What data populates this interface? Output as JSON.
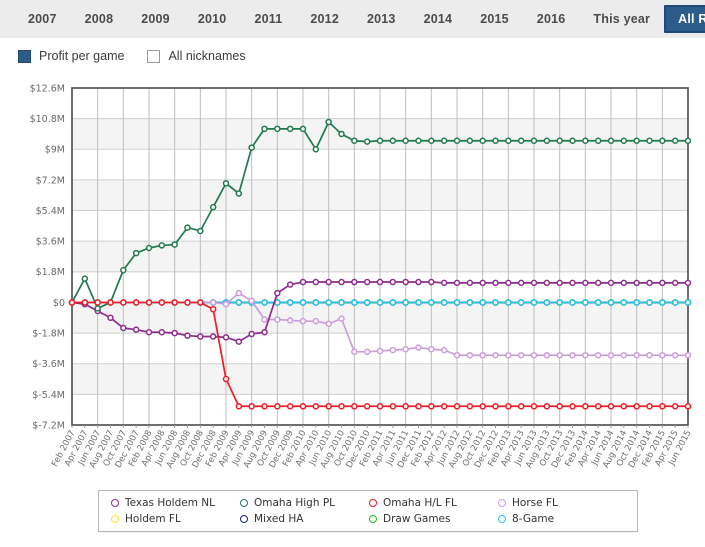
{
  "toolbar": {
    "tabs": [
      {
        "label": "2007",
        "active": false
      },
      {
        "label": "2008",
        "active": false
      },
      {
        "label": "2009",
        "active": false
      },
      {
        "label": "2010",
        "active": false
      },
      {
        "label": "2011",
        "active": false
      },
      {
        "label": "2012",
        "active": false
      },
      {
        "label": "2013",
        "active": false
      },
      {
        "label": "2014",
        "active": false
      },
      {
        "label": "2015",
        "active": false
      },
      {
        "label": "2016",
        "active": false
      },
      {
        "label": "This year",
        "active": false
      },
      {
        "label": "All Results",
        "active": true
      }
    ],
    "active_color": "#2e5c8a"
  },
  "options": [
    {
      "label": "Profit per game",
      "checked": true
    },
    {
      "label": "All nicknames",
      "checked": false
    }
  ],
  "chart_data": {
    "type": "line",
    "title": "",
    "xlabel": "",
    "ylabel": "",
    "ylim": [
      -7.2,
      12.6
    ],
    "ytick_values": [
      12.6,
      10.8,
      9,
      7.2,
      5.4,
      3.6,
      1.8,
      0,
      -1.8,
      -3.6,
      -5.4,
      -7.2
    ],
    "ytick_labels": [
      "$12.6M",
      "$10.8M",
      "$9M",
      "$7.2M",
      "$5.4M",
      "$3.6M",
      "$1.8M",
      "$0",
      "$-1.8M",
      "$-3.6M",
      "$-5.4M",
      "$-7.2M"
    ],
    "grid": true,
    "legend_position": "bottom",
    "units": "millions of dollars",
    "categories": [
      "Feb 2007",
      "Apr 2007",
      "Jun 2007",
      "Aug 2007",
      "Oct 2007",
      "Dec 2007",
      "Feb 2008",
      "Apr 2008",
      "Jun 2008",
      "Aug 2008",
      "Oct 2008",
      "Dec 2008",
      "Feb 2009",
      "Apr 2009",
      "Jun 2009",
      "Aug 2009",
      "Oct 2009",
      "Dec 2009",
      "Feb 2010",
      "Apr 2010",
      "Jun 2010",
      "Aug 2010",
      "Oct 2010",
      "Dec 2010",
      "Feb 2011",
      "Apr 2011",
      "Jun 2011",
      "Dec 2011",
      "Feb 2012",
      "Apr 2012",
      "Jun 2012",
      "Aug 2012",
      "Oct 2012",
      "Dec 2012",
      "Feb 2013",
      "Apr 2013",
      "Jun 2013",
      "Aug 2013",
      "Oct 2013",
      "Dec 2013",
      "Feb 2014",
      "Apr 2014",
      "Jun 2014",
      "Aug 2014",
      "Oct 2014",
      "Dec 2014",
      "Feb 2015",
      "Apr 2015",
      "Jun 2015"
    ],
    "series": [
      {
        "name": "Texas Holdem NL",
        "color": "#8e2b8e",
        "values": [
          0.0,
          -0.1,
          -0.5,
          -0.9,
          -1.5,
          -1.6,
          -1.75,
          -1.75,
          -1.8,
          -1.95,
          -2.0,
          -2.0,
          -2.05,
          -2.3,
          -1.85,
          -1.75,
          0.55,
          1.05,
          1.2,
          1.2,
          1.2,
          1.2,
          1.2,
          1.2,
          1.2,
          1.2,
          1.2,
          1.2,
          1.2,
          1.15,
          1.15,
          1.15,
          1.15,
          1.15,
          1.15,
          1.15,
          1.15,
          1.15,
          1.15,
          1.15,
          1.15,
          1.15,
          1.15,
          1.15,
          1.15,
          1.15,
          1.15,
          1.15,
          1.15
        ]
      },
      {
        "name": "Omaha High PL",
        "color": "#1f7a4d",
        "values": [
          0.0,
          1.4,
          -0.35,
          0.0,
          1.9,
          2.9,
          3.2,
          3.35,
          3.4,
          4.4,
          4.2,
          5.6,
          7.0,
          6.4,
          9.1,
          10.2,
          10.2,
          10.2,
          10.2,
          9.0,
          10.6,
          9.9,
          9.5,
          9.45,
          9.5,
          9.5,
          9.5,
          9.5,
          9.5,
          9.5,
          9.5,
          9.5,
          9.5,
          9.5,
          9.5,
          9.5,
          9.5,
          9.5,
          9.5,
          9.5,
          9.5,
          9.5,
          9.5,
          9.5,
          9.5,
          9.5,
          9.5,
          9.5,
          9.5
        ]
      },
      {
        "name": "Omaha H/L FL",
        "color": "#ee1c25",
        "values": [
          0.0,
          0.0,
          0.0,
          0.0,
          0.0,
          0.0,
          0.0,
          0.0,
          0.0,
          0.0,
          0.0,
          -0.4,
          -4.5,
          -6.1,
          -6.1,
          -6.1,
          -6.1,
          -6.1,
          -6.1,
          -6.1,
          -6.1,
          -6.1,
          -6.1,
          -6.1,
          -6.1,
          -6.1,
          -6.1,
          -6.1,
          -6.1,
          -6.1,
          -6.1,
          -6.1,
          -6.1,
          -6.1,
          -6.1,
          -6.1,
          -6.1,
          -6.1,
          -6.1,
          -6.1,
          -6.1,
          -6.1,
          -6.1,
          -6.1,
          -6.1,
          -6.1,
          -6.1,
          -6.1,
          -6.1
        ]
      },
      {
        "name": "Horse FL",
        "color": "#cc9ddb",
        "values": [
          0.0,
          0.0,
          0.0,
          0.0,
          0.0,
          0.0,
          0.0,
          0.0,
          0.0,
          0.0,
          0.0,
          0.0,
          -0.1,
          0.55,
          0.1,
          -1.0,
          -1.0,
          -1.05,
          -1.1,
          -1.1,
          -1.25,
          -0.95,
          -2.9,
          -2.9,
          -2.85,
          -2.8,
          -2.75,
          -2.65,
          -2.75,
          -2.8,
          -3.1,
          -3.1,
          -3.1,
          -3.1,
          -3.1,
          -3.1,
          -3.1,
          -3.1,
          -3.1,
          -3.1,
          -3.1,
          -3.1,
          -3.1,
          -3.1,
          -3.1,
          -3.1,
          -3.1,
          -3.1,
          -3.1
        ]
      },
      {
        "name": "Holdem FL",
        "color": "#f5e42a",
        "values": [
          0,
          0,
          0,
          0,
          0,
          0,
          0,
          0,
          0,
          0,
          0,
          0,
          0,
          0,
          0,
          0,
          0,
          0,
          0,
          0,
          0,
          0,
          0,
          0,
          0,
          0,
          0,
          0,
          0,
          0,
          0,
          0,
          0,
          0,
          0,
          0,
          0,
          0,
          0,
          0,
          0,
          0,
          0,
          0,
          0,
          0,
          0,
          0,
          0
        ]
      },
      {
        "name": "Mixed HA",
        "color": "#15218c",
        "values": [
          0,
          0,
          0,
          0,
          0,
          0,
          0,
          0,
          0,
          0,
          0,
          0,
          0,
          0,
          0,
          0,
          0,
          0,
          0,
          0,
          0,
          0,
          0,
          0,
          0,
          0,
          0,
          0,
          0,
          0,
          0,
          0,
          0,
          0,
          0,
          0,
          0,
          0,
          0,
          0,
          0,
          0,
          0,
          0,
          0,
          0,
          0,
          0,
          0
        ]
      },
      {
        "name": "Draw Games",
        "color": "#17c217",
        "values": [
          0,
          0,
          0,
          0,
          0,
          0,
          0,
          0,
          0,
          0,
          0,
          0,
          0,
          0,
          0,
          0,
          0,
          0,
          0,
          0,
          0,
          0,
          0,
          0,
          0,
          0,
          0,
          0,
          0,
          0,
          0,
          0,
          0,
          0,
          0,
          0,
          0,
          0,
          0,
          0,
          0,
          0,
          0,
          0,
          0,
          0,
          0,
          0,
          0
        ]
      },
      {
        "name": "8-Game",
        "color": "#29c5e8",
        "values": [
          0,
          0,
          0,
          0,
          0,
          0,
          0,
          0,
          0,
          0,
          0,
          0,
          0,
          0,
          0,
          0,
          0,
          0,
          0,
          0,
          0,
          0,
          0,
          0,
          0,
          0,
          0,
          0,
          0,
          0,
          0,
          0,
          0,
          0,
          0,
          0,
          0,
          0,
          0,
          0,
          0,
          0,
          0,
          0,
          0,
          0,
          0,
          0,
          0
        ]
      }
    ]
  }
}
